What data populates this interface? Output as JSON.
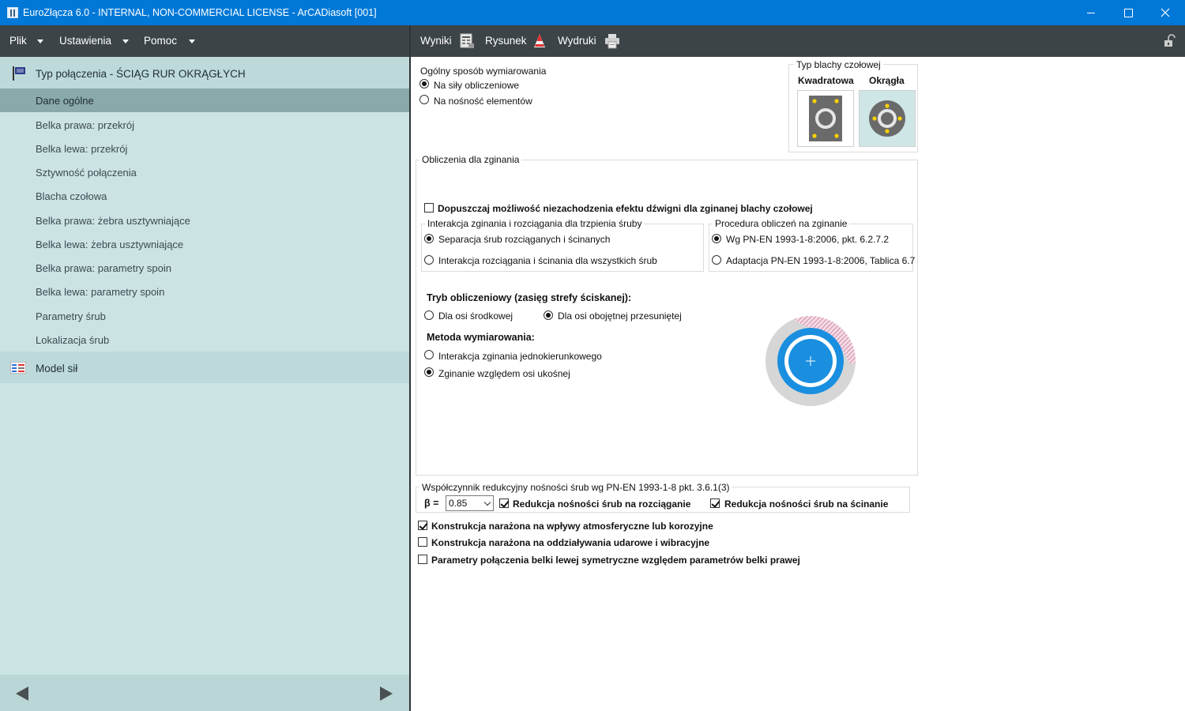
{
  "window": {
    "title": "EuroZłącza 6.0 - INTERNAL, NON-COMMERCIAL LICENSE - ArCADiasoft [001]"
  },
  "menu": {
    "file": "Plik",
    "settings": "Ustawienia",
    "help": "Pomoc"
  },
  "toolbar": {
    "results": "Wyniki",
    "drawing": "Rysunek",
    "prints": "Wydruki"
  },
  "sidebar": {
    "header": "Typ połączenia - ŚCIĄG RUR OKRĄGŁYCH",
    "items": [
      "Dane ogólne",
      "Belka prawa: przekrój",
      "Belka lewa: przekrój",
      "Sztywność połączenia",
      "Blacha czołowa",
      "Belka prawa: żebra usztywniające",
      "Belka lewa: żebra usztywniające",
      "Belka prawa: parametry spoin",
      "Belka lewa: parametry spoin",
      "Parametry śrub",
      "Lokalizacja śrub"
    ],
    "model": "Model sił"
  },
  "dimensioning": {
    "title": "Ogólny sposób wymiarowania",
    "option1": "Na siły obliczeniowe",
    "option2": "Na nośność elementów"
  },
  "plate_type": {
    "title": "Typ blachy czołowej",
    "square": "Kwadratowa",
    "round": "Okrągła"
  },
  "bending": {
    "title": "Obliczenia dla zginania",
    "prying_check": "Dopuszczaj możliwość niezachodzenia efektu dźwigni dla zginanej blachy czołowej",
    "interaction": {
      "title": "Interakcja zginania i rozciągania dla trzpienia śruby",
      "option1": "Separacja śrub rozciąganych i ścinanych",
      "option2": "Interakcja rozciągania i ścinania dla wszystkich śrub"
    },
    "procedure": {
      "title": "Procedura obliczeń na zginanie",
      "option1": "Wg PN-EN 1993-1-8:2006, pkt. 6.2.7.2",
      "option2": "Adaptacja PN-EN 1993-1-8:2006, Tablica 6.7"
    },
    "mode": {
      "title": "Tryb obliczeniowy (zasięg strefy ściskanej):",
      "option1": "Dla osi środkowej",
      "option2": "Dla osi obojętnej przesuniętej"
    },
    "method": {
      "title": "Metoda wymiarowania:",
      "option1": "Interakcja zginania jednokierunkowego",
      "option2": "Zginanie względem osi ukośnej"
    }
  },
  "reduction": {
    "title": "Współczynnik redukcyjny nośności śrub wg PN-EN 1993-1-8 pkt. 3.6.1(3)",
    "beta_label": "β =",
    "beta_value": "0.85",
    "tension": "Redukcja nośności śrub na rozciąganie",
    "shear": "Redukcja nośności śrub na ścinanie"
  },
  "options": {
    "corrosive": "Konstrukcja narażona na wpływy atmosferyczne lub korozyjne",
    "impact": "Konstrukcja narażona na oddziaływania udarowe i wibracyjne",
    "symmetric": "Parametry połączenia belki lewej symetryczne względem parametrów belki prawej"
  },
  "colors": {
    "titlebar": "#0078d7",
    "menubar": "#3c4447",
    "sidebar": "#cce3e3",
    "sidebar_active": "#8aa9a9",
    "accent_blue": "#1a8fe0"
  }
}
